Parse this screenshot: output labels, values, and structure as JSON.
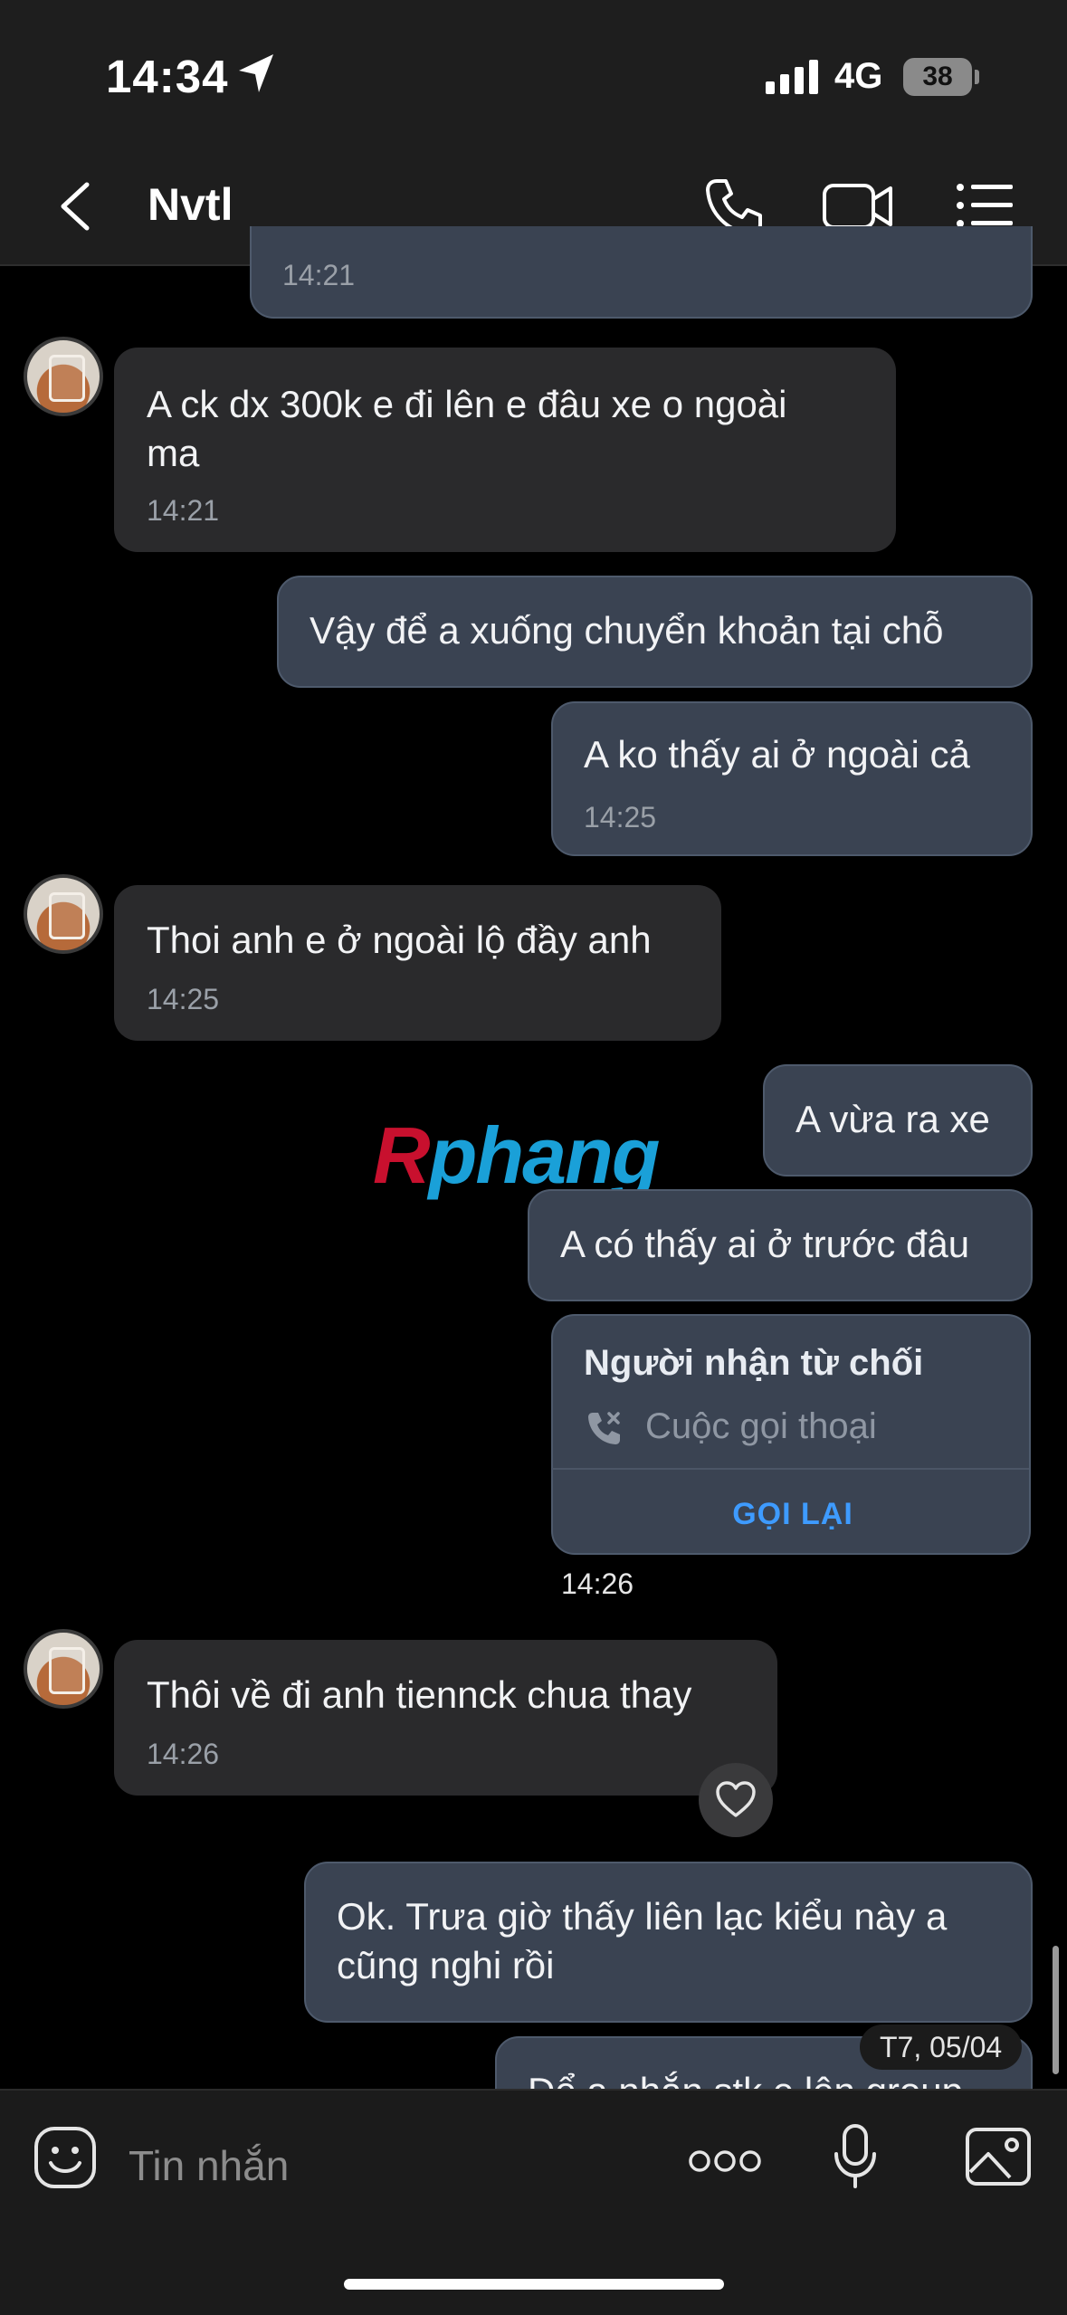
{
  "status": {
    "time": "14:34",
    "network": "4G",
    "battery": "38"
  },
  "header": {
    "title": "Nvtl"
  },
  "messages": {
    "m0": {
      "time": "14:21"
    },
    "m1": {
      "text": "A ck dx 300k e đi lên e đâu xe o ngoài\nma",
      "time": "14:21"
    },
    "m2": {
      "text": "Vậy để a xuống chuyển khoản tại chỗ"
    },
    "m3": {
      "text": "A ko thấy ai ở ngoài cả",
      "time": "14:25"
    },
    "m4": {
      "text": "Thoi anh e ở ngoài lộ đầy anh",
      "time": "14:25"
    },
    "m5": {
      "text": "A vừa ra xe"
    },
    "m6": {
      "text": "A có thấy ai ở trước đâu"
    },
    "call": {
      "title": "Người nhận từ chối",
      "subtitle": "Cuộc gọi thoại",
      "action": "GỌI LẠI",
      "time": "14:26"
    },
    "m7": {
      "text": "Thôi về đi anh tiennck chua thay",
      "time": "14:26"
    },
    "m8": {
      "text": "Ok. Trưa giờ thấy liên lạc kiểu này a\ncũng nghi rồi"
    },
    "m9": {
      "text": "Để a nhắn stk e lên group"
    }
  },
  "date_pill": "T7, 05/04",
  "watermark": {
    "first": "R",
    "rest": "phang"
  },
  "input": {
    "placeholder": "Tin nhắn"
  },
  "colors": {
    "incoming": "#2a2a2c",
    "outgoing": "#3a4352",
    "accent": "#3e9bff"
  }
}
